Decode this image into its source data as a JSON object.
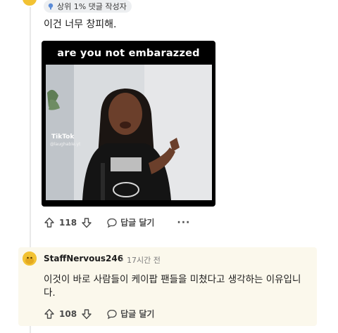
{
  "top_comment": {
    "badge_label": "상위 1% 댓글 작성자",
    "text": "이건 너무 창피해.",
    "video": {
      "caption": "are you not embarazzed",
      "watermark_title": "TikTok",
      "watermark_handle": "@laughable.yt"
    },
    "actions": {
      "vote_count": "118",
      "reply_label": "답글 달기",
      "more_label": "···"
    }
  },
  "reply_comment": {
    "username": "StaffNervous246",
    "meta": "• 17시간 전",
    "text": "이것이 바로 사람들이 케이팝 팬들을 미쳤다고 생각하는 이유입니다.",
    "actions": {
      "vote_count": "108",
      "reply_label": "답글 달기"
    }
  },
  "colors": {
    "avatar": "#f2c233",
    "reply_background": "#fbf8ec",
    "badge_background": "#edeff1"
  }
}
